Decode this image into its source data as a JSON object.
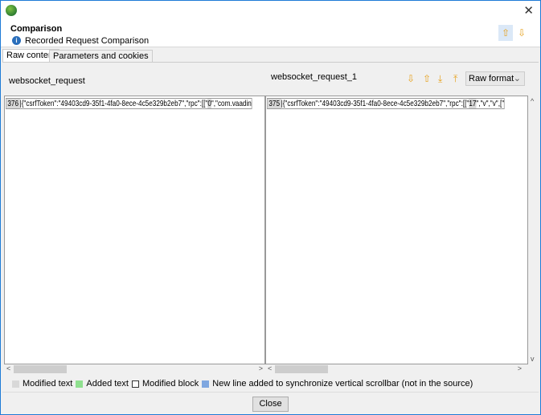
{
  "header": {
    "title": "Comparison",
    "subtitle": "Recorded Request Comparison"
  },
  "tabs": [
    {
      "label": "Raw content"
    },
    {
      "label": "Parameters and cookies"
    }
  ],
  "left": {
    "label": "websocket_request",
    "line_number": "376",
    "text_a": "|{\"csrfToken\":\"49403cd9-35f1-4fa0-8ece-4c5e329b2eb7\",\"rpc\":[[\"",
    "mod": "0",
    "text_b": "\",\"com.vaadin"
  },
  "right": {
    "label": "websocket_request_1",
    "line_number": "375",
    "text_a": "|{\"csrfToken\":\"49403cd9-35f1-4fa0-8ece-4c5e329b2eb7\",\"rpc\":[[\"",
    "mod": "17",
    "text_b": "\",\"v\",\"v\",[\""
  },
  "format_select": {
    "value": "Raw format"
  },
  "legend": [
    {
      "label": "Modified text",
      "color": "#d8d8d8"
    },
    {
      "label": "Added text",
      "color": "#8fe08f"
    },
    {
      "label": "Modified block",
      "color": "#ffffff"
    },
    {
      "label": "New line added to synchronize vertical scrollbar (not in the source)",
      "color": "#7fa7e0"
    }
  ],
  "close_label": "Close"
}
